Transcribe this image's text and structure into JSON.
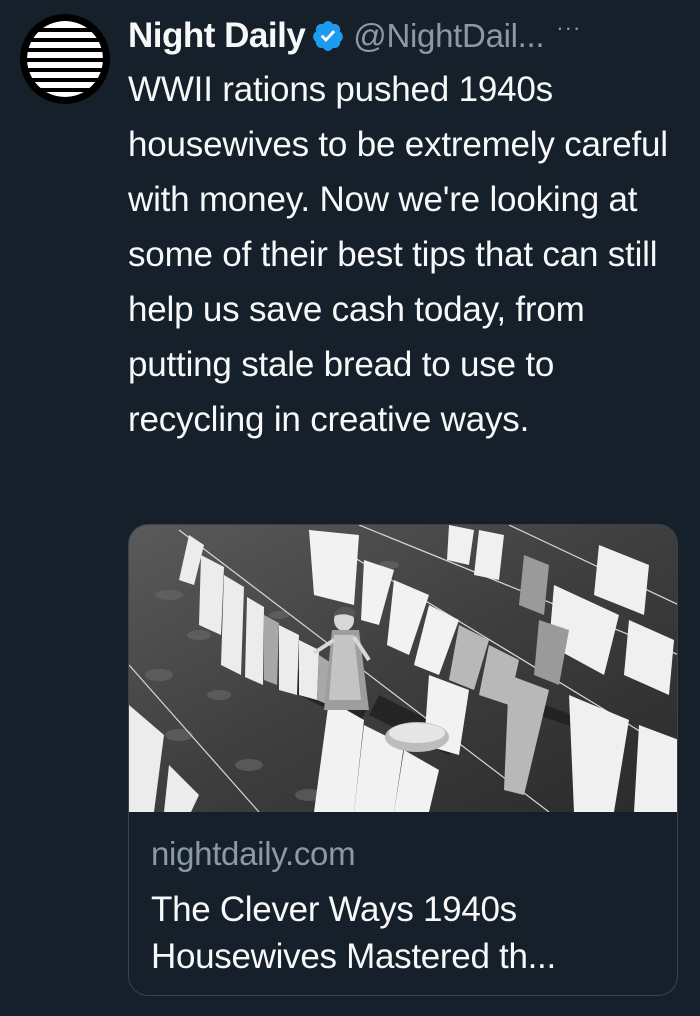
{
  "author": {
    "display_name": "Night Daily",
    "handle": "@NightDail...",
    "verified": true,
    "avatar_icon": "striped-circle-logo-icon",
    "verified_icon": "verified-badge-icon"
  },
  "more_label": "···",
  "tweet": {
    "text": "WWII rations pushed 1940s housewives to be extremely careful with money. Now we're looking at some of their best tips that can still help us save cash today, from putting stale bread to use to recycling in creative ways."
  },
  "card": {
    "domain": "nightdaily.com",
    "title_line1": "The Clever Ways 1940s",
    "title_line2": "Housewives Mastered th..."
  },
  "colors": {
    "background": "#15202b",
    "text_primary": "#f7f9f9",
    "text_secondary": "#8b98a5",
    "verified_blue": "#1d9bf0",
    "border": "#38444d"
  }
}
